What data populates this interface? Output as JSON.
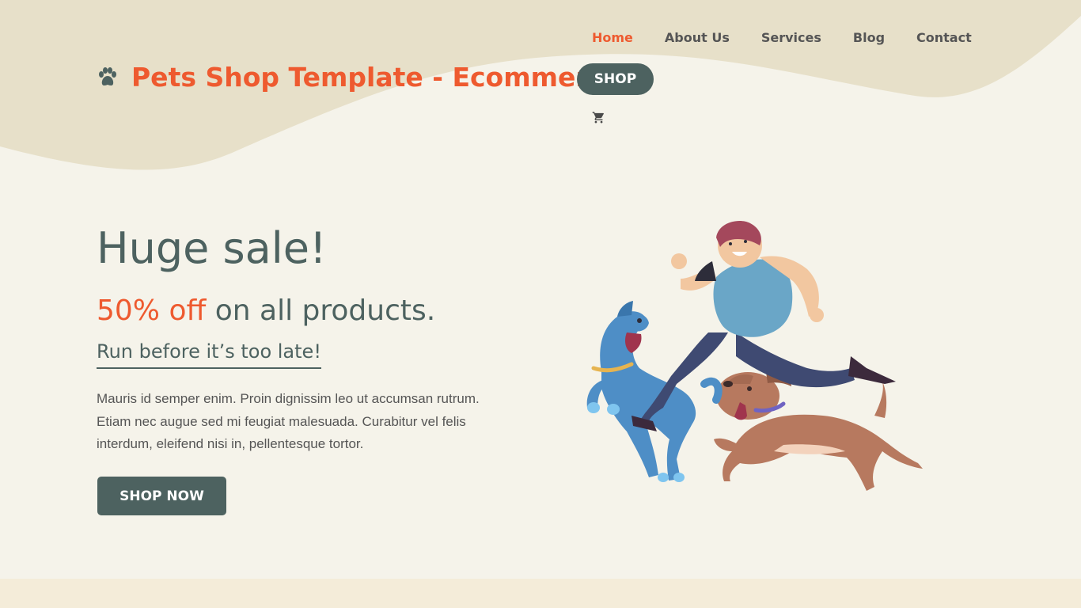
{
  "nav": {
    "items": [
      {
        "label": "Home",
        "active": true
      },
      {
        "label": "About Us",
        "active": false
      },
      {
        "label": "Services",
        "active": false
      },
      {
        "label": "Blog",
        "active": false
      },
      {
        "label": "Contact",
        "active": false
      }
    ]
  },
  "brand": {
    "name": "Pets Shop Template - Ecommerce",
    "icon": "paw-icon"
  },
  "header": {
    "shop_label": "SHOP",
    "cart_icon": "cart-icon"
  },
  "hero": {
    "title": "Huge sale!",
    "sub_highlight": "50% off",
    "sub_rest": " on all products.",
    "tagline": "Run before it’s too late!",
    "paragraph": "Mauris id semper enim. Proin dignissim leo ut accumsan rutrum. Etiam nec augue sed mi feugiat malesuada. Curabitur vel felis interdum, eleifend nisi in, pellentesque tortor.",
    "button_label": "SHOP NOW"
  },
  "colors": {
    "accent": "#ee5a2f",
    "primary": "#4d6260",
    "bg": "#f5f3ea",
    "wave": "#e7e0c9"
  }
}
